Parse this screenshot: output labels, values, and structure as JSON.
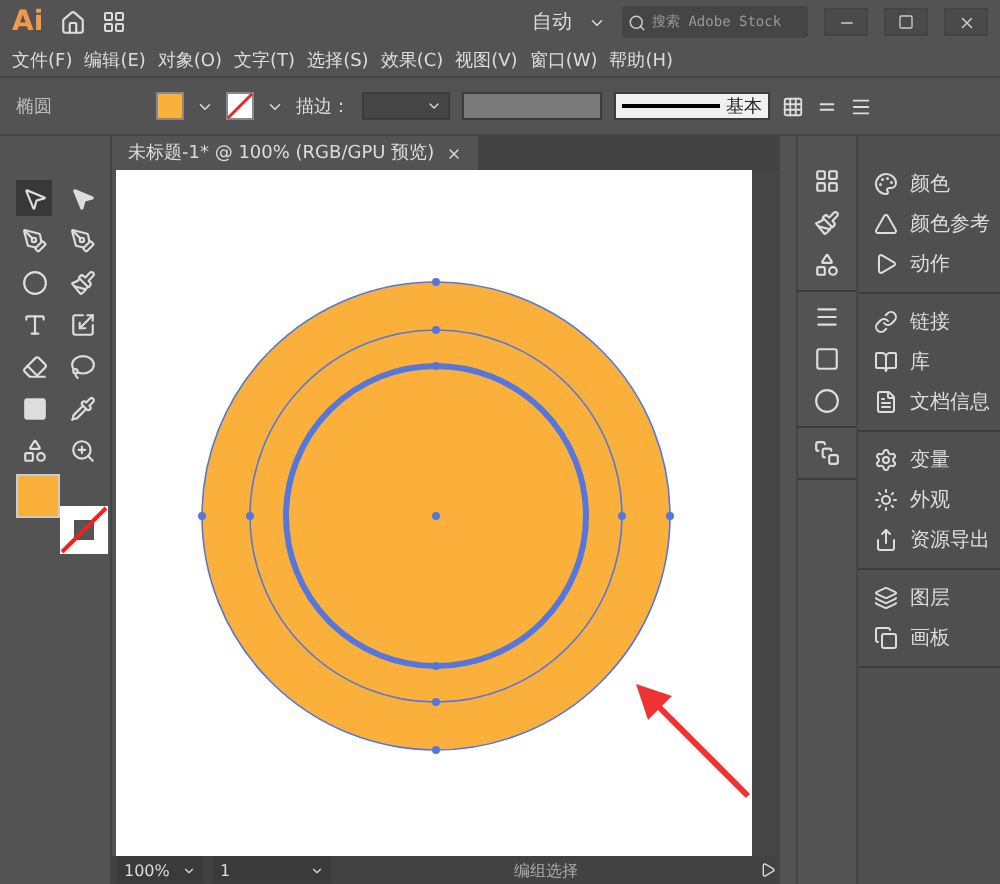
{
  "app": {
    "logo": "Ai",
    "workspace": "自动",
    "search": {
      "placeholder": "搜索 Adobe Stock"
    }
  },
  "menu": [
    "文件(F)",
    "编辑(E)",
    "对象(O)",
    "文字(T)",
    "选择(S)",
    "效果(C)",
    "视图(V)",
    "窗口(W)",
    "帮助(H)"
  ],
  "control_bar": {
    "object_type": "椭圆",
    "stroke_label": "描边：",
    "brush": "基本"
  },
  "document_tab": {
    "title": "未标题-1* @ 100% (RGB/GPU 预览)"
  },
  "tools": [
    {
      "selected": true
    },
    {
      "selected": false
    },
    {
      "selected": false
    },
    {
      "selected": false
    },
    {
      "selected": false
    },
    {
      "selected": false
    },
    {
      "selected": false
    },
    {
      "selected": false
    },
    {
      "selected": false
    },
    {
      "selected": false
    },
    {
      "selected": false
    },
    {
      "selected": false
    },
    {
      "selected": false
    },
    {
      "selected": false
    }
  ],
  "panel_groups": [
    {
      "items": [
        {
          "label": "颜色"
        },
        {
          "label": "颜色参考"
        },
        {
          "label": "动作"
        }
      ]
    },
    {
      "items": [
        {
          "label": "链接"
        },
        {
          "label": "库"
        },
        {
          "label": "文档信息"
        }
      ]
    },
    {
      "items": [
        {
          "label": "变量"
        },
        {
          "label": "外观"
        },
        {
          "label": "资源导出"
        }
      ]
    },
    {
      "items": [
        {
          "label": "图层"
        },
        {
          "label": "画板"
        }
      ]
    }
  ],
  "status_bar": {
    "zoom": "100%",
    "artboard": "1",
    "tool": "编组选择"
  }
}
